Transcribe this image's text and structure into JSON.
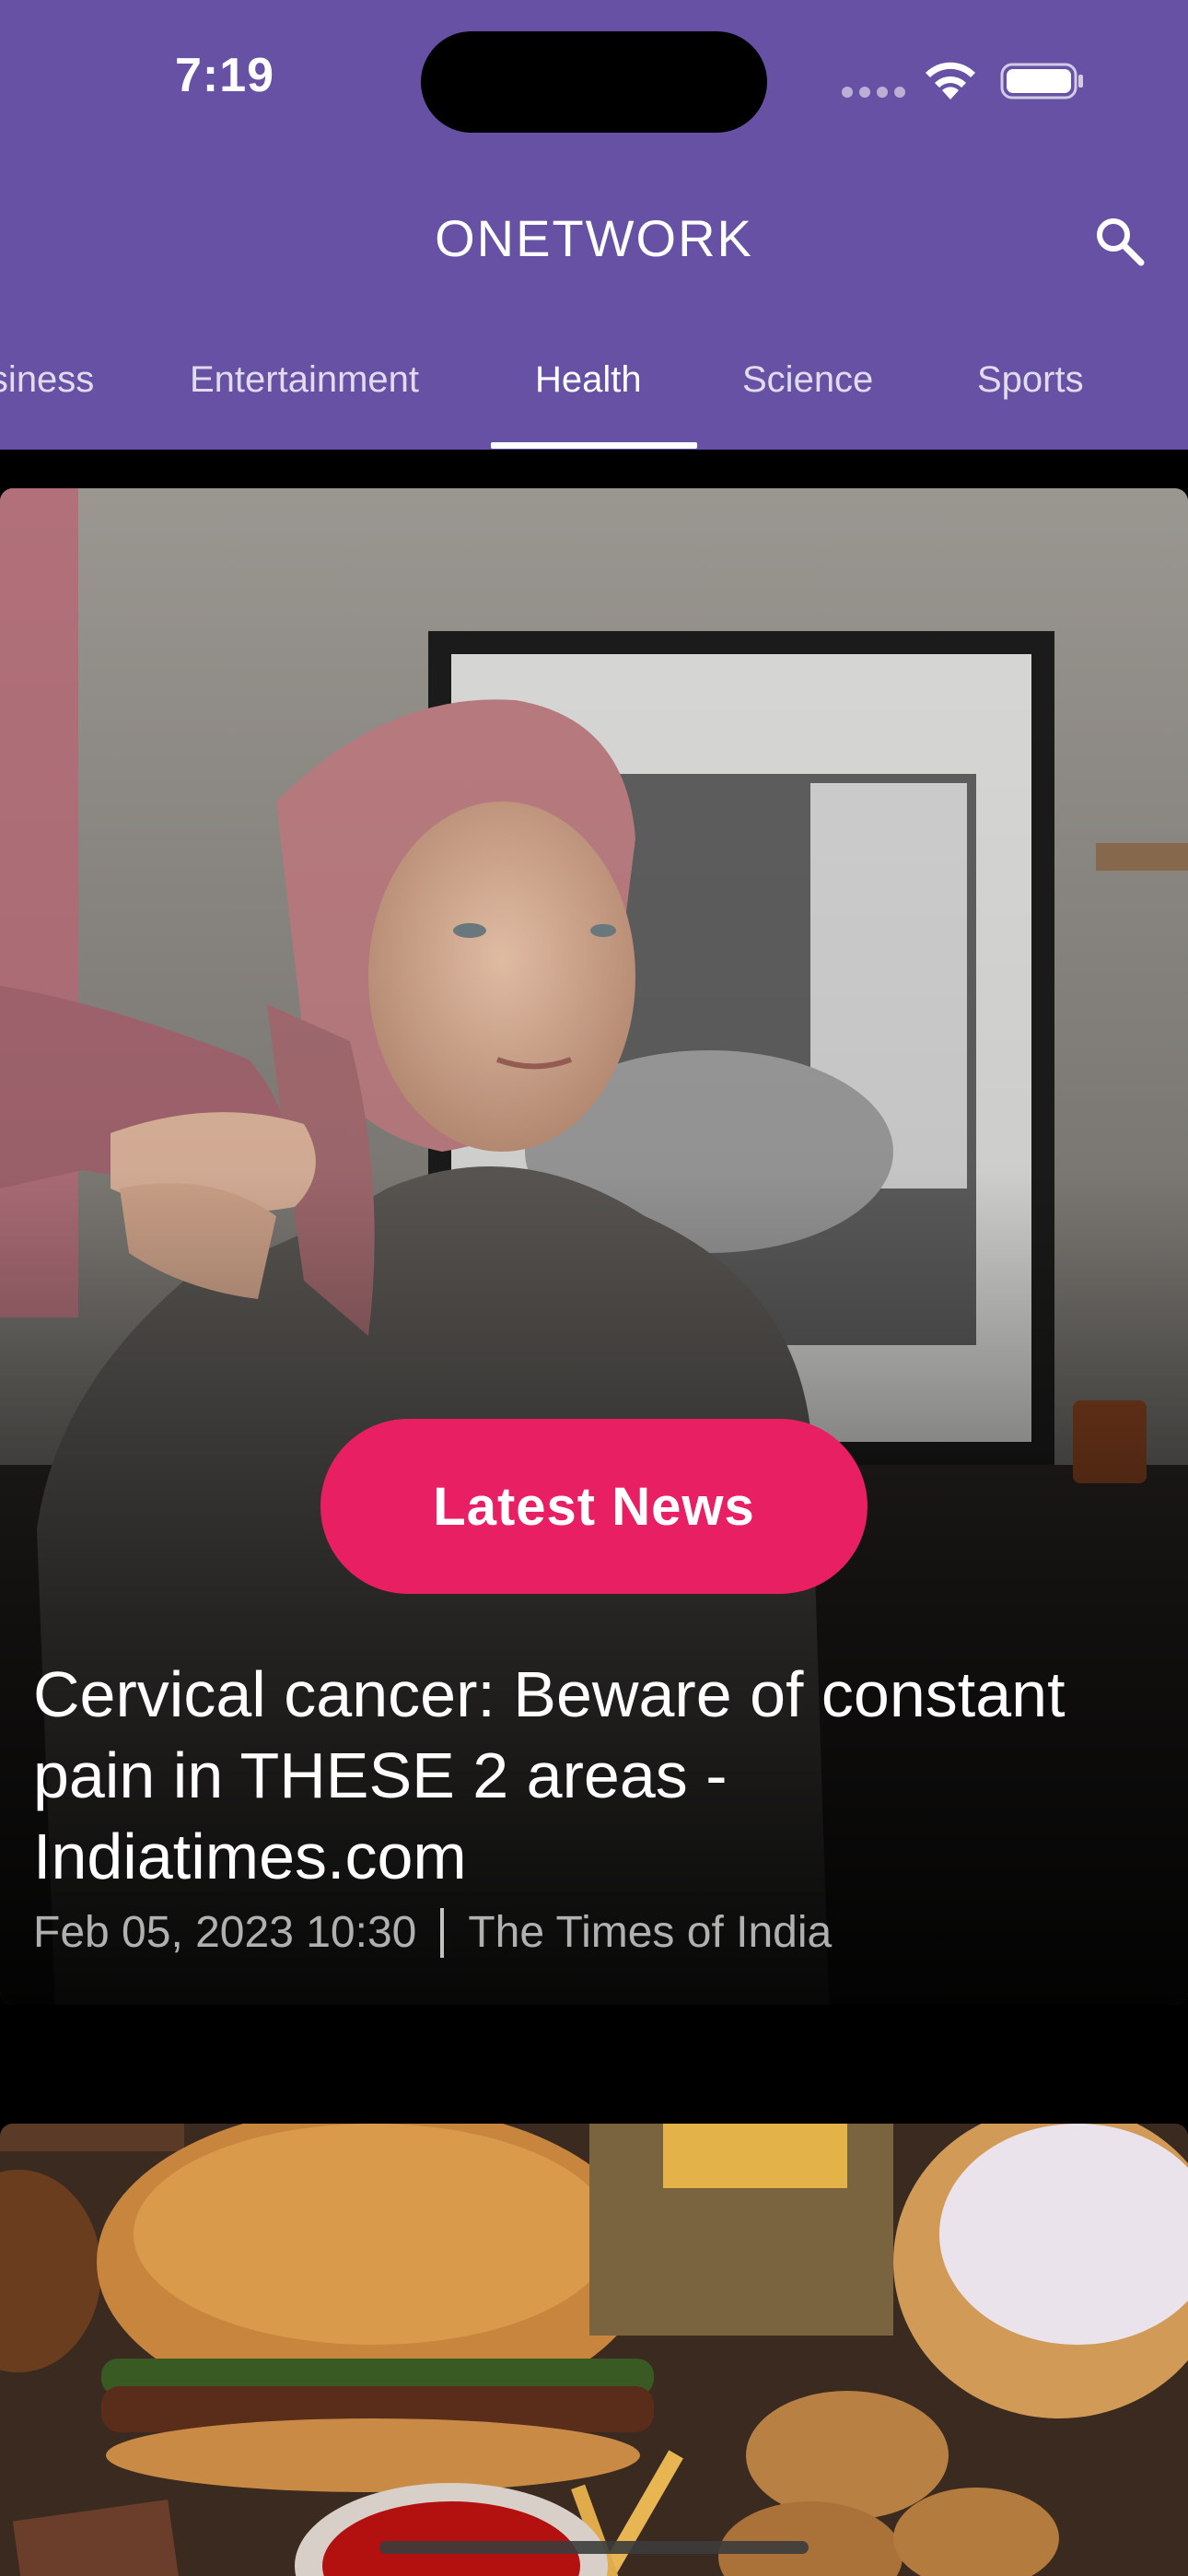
{
  "status_bar": {
    "time": "7:19"
  },
  "app": {
    "title": "ONETWORK"
  },
  "tabs": [
    {
      "label": "Business"
    },
    {
      "label": "Entertainment"
    },
    {
      "label": "Health"
    },
    {
      "label": "Science"
    },
    {
      "label": "Sports"
    }
  ],
  "active_tab": "Health",
  "articles": [
    {
      "badge": "Latest News",
      "title": "Cervical cancer: Beware of constant pain in THESE 2 areas - Indiatimes.com",
      "date": "Feb 05, 2023 10:30",
      "source": "The Times of India",
      "image": "woman-headscarf-photo"
    },
    {
      "image": "junk-food-photo"
    }
  ],
  "colors": {
    "header": "#6651a5",
    "badge": "#e91f63",
    "background": "#000000"
  },
  "icons": {
    "search": "search-icon",
    "wifi": "wifi-icon",
    "battery": "battery-icon",
    "signal": "signal-icon"
  }
}
